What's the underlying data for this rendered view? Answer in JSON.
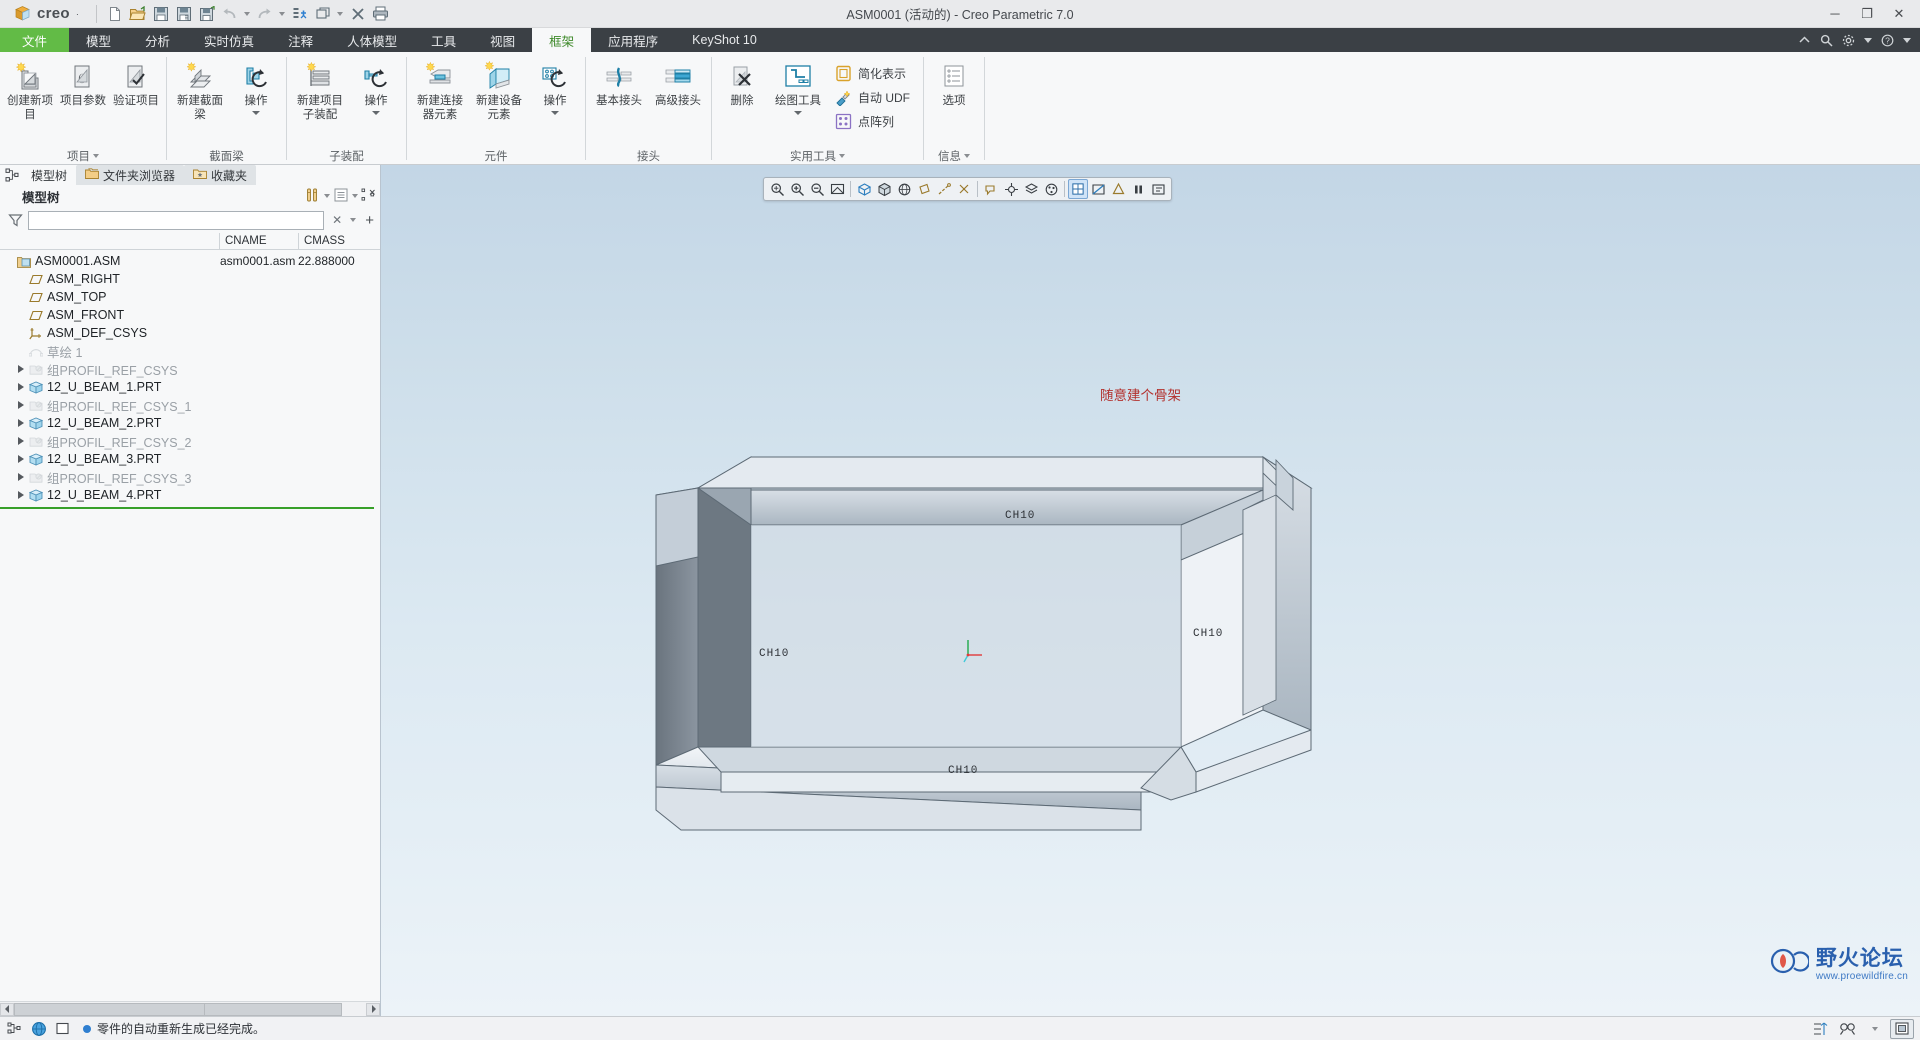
{
  "titlebar": {
    "app_name": "creo",
    "registered_mark": "·",
    "title": "ASM0001 (活动的) - Creo Parametric 7.0",
    "quick_access": [
      {
        "name": "new-file-button",
        "icon": "new-document-icon"
      },
      {
        "name": "open-file-button",
        "icon": "open-folder-icon"
      },
      {
        "name": "save-button",
        "icon": "save-disk-icon"
      },
      {
        "name": "save-as-button",
        "icon": "save-as-icon"
      },
      {
        "name": "save-copy-button",
        "icon": "save-copy-icon"
      },
      {
        "name": "undo-button",
        "icon": "undo-arrow-icon"
      },
      {
        "name": "redo-button",
        "icon": "redo-arrow-icon"
      },
      {
        "name": "regenerate-button",
        "icon": "regenerate-icon"
      },
      {
        "name": "window-button",
        "icon": "window-icon"
      },
      {
        "name": "close-window-button",
        "icon": "close-x-icon"
      },
      {
        "name": "print-button",
        "icon": "printer-icon"
      }
    ],
    "window_controls": {
      "minimize": "─",
      "maximize": "❐",
      "close": "✕"
    }
  },
  "tabs": [
    {
      "label": "文件",
      "name": "tab-file",
      "kind": "file"
    },
    {
      "label": "模型",
      "name": "tab-model",
      "kind": "normal"
    },
    {
      "label": "分析",
      "name": "tab-analysis",
      "kind": "normal"
    },
    {
      "label": "实时仿真",
      "name": "tab-realtime-sim",
      "kind": "normal"
    },
    {
      "label": "注释",
      "name": "tab-annotate",
      "kind": "normal"
    },
    {
      "label": "人体模型",
      "name": "tab-manikin",
      "kind": "normal"
    },
    {
      "label": "工具",
      "name": "tab-tools",
      "kind": "normal"
    },
    {
      "label": "视图",
      "name": "tab-view",
      "kind": "normal"
    },
    {
      "label": "框架",
      "name": "tab-framework",
      "kind": "active"
    },
    {
      "label": "应用程序",
      "name": "tab-applications",
      "kind": "normal"
    },
    {
      "label": "KeyShot 10",
      "name": "tab-keyshot",
      "kind": "normal"
    }
  ],
  "ribbon": {
    "groups": [
      {
        "name": "group-project",
        "label": "项目",
        "has_caret": true,
        "items": [
          {
            "name": "create-new-project-button",
            "label": "创建新项目",
            "icon": "new-project-icon",
            "caret": false,
            "size": "big"
          },
          {
            "name": "project-params-button",
            "label": "项目参数",
            "icon": "project-params-icon",
            "caret": false,
            "size": "big"
          },
          {
            "name": "verify-project-button",
            "label": "验证项目",
            "icon": "verify-project-icon",
            "caret": false,
            "size": "big"
          }
        ]
      },
      {
        "name": "group-section-beam",
        "label": "截面梁",
        "has_caret": false,
        "items": [
          {
            "name": "new-section-beam-button",
            "label": "新建截面梁",
            "icon": "new-beam-icon",
            "caret": false,
            "size": "big"
          },
          {
            "name": "beam-operations-button",
            "label": "操作",
            "icon": "beam-operations-icon",
            "caret": true,
            "size": "big"
          }
        ]
      },
      {
        "name": "group-subassembly",
        "label": "子装配",
        "has_caret": false,
        "items": [
          {
            "name": "new-project-subassembly-button",
            "label": "新建项目子装配",
            "icon": "new-subassembly-icon",
            "caret": false,
            "size": "big"
          },
          {
            "name": "subassembly-operations-button",
            "label": "操作",
            "icon": "subassembly-operations-icon",
            "caret": true,
            "size": "big"
          }
        ]
      },
      {
        "name": "group-component",
        "label": "元件",
        "has_caret": false,
        "items": [
          {
            "name": "new-connector-element-button",
            "label": "新建连接器元素",
            "icon": "new-connector-icon",
            "caret": false,
            "size": "big"
          },
          {
            "name": "new-equipment-element-button",
            "label": "新建设备元素",
            "icon": "new-equipment-icon",
            "caret": false,
            "size": "big"
          },
          {
            "name": "component-operations-button",
            "label": "操作",
            "icon": "component-operations-icon",
            "caret": true,
            "size": "big"
          }
        ]
      },
      {
        "name": "group-joint",
        "label": "接头",
        "has_caret": false,
        "items": [
          {
            "name": "basic-joint-button",
            "label": "基本接头",
            "icon": "basic-joint-icon",
            "caret": false,
            "size": "big"
          },
          {
            "name": "advanced-joint-button",
            "label": "高级接头",
            "icon": "advanced-joint-icon",
            "caret": false,
            "size": "big"
          }
        ]
      },
      {
        "name": "group-utilities",
        "label": "实用工具",
        "has_caret": true,
        "items": [
          {
            "name": "delete-button",
            "label": "删除",
            "icon": "delete-icon",
            "caret": false,
            "size": "big"
          },
          {
            "name": "drawing-tools-button",
            "label": "绘图工具",
            "icon": "drawing-tools-icon",
            "caret": true,
            "size": "big"
          }
        ],
        "small_items": [
          {
            "name": "simplified-rep-button",
            "label": "简化表示",
            "icon": "simplified-rep-icon"
          },
          {
            "name": "auto-udf-button",
            "label": "自动 UDF",
            "icon": "auto-udf-icon"
          },
          {
            "name": "point-array-button",
            "label": "点阵列",
            "icon": "point-array-icon"
          }
        ]
      },
      {
        "name": "group-info",
        "label": "信息",
        "has_caret": true,
        "items": [
          {
            "name": "options-button",
            "label": "选项",
            "icon": "options-icon",
            "caret": false,
            "size": "big"
          }
        ]
      }
    ]
  },
  "left_panel": {
    "nav_tabs": [
      {
        "label": "模型树",
        "name": "nav-tab-model-tree",
        "icon": "model-tree-icon",
        "active": true
      },
      {
        "label": "文件夹浏览器",
        "name": "nav-tab-folder-browser",
        "icon": "folder-browser-icon",
        "active": false
      },
      {
        "label": "收藏夹",
        "name": "nav-tab-favorites",
        "icon": "favorites-folder-icon",
        "active": false
      }
    ],
    "tree_title": "模型树",
    "filter_value": "",
    "filter_placeholder": "",
    "columns": [
      "",
      "CNAME",
      "CMASS"
    ],
    "tree": [
      {
        "label": "ASM0001.ASM",
        "icon": "assembly-icon",
        "indent": 0,
        "expander": false,
        "dim": false,
        "cname": "asm0001.asm",
        "cmass": "22.888000"
      },
      {
        "label": "ASM_RIGHT",
        "icon": "datum-plane-icon",
        "indent": 1,
        "expander": false,
        "dim": false,
        "cname": "",
        "cmass": ""
      },
      {
        "label": "ASM_TOP",
        "icon": "datum-plane-icon",
        "indent": 1,
        "expander": false,
        "dim": false,
        "cname": "",
        "cmass": ""
      },
      {
        "label": "ASM_FRONT",
        "icon": "datum-plane-icon",
        "indent": 1,
        "expander": false,
        "dim": false,
        "cname": "",
        "cmass": ""
      },
      {
        "label": "ASM_DEF_CSYS",
        "icon": "coordinate-system-icon",
        "indent": 1,
        "expander": false,
        "dim": false,
        "cname": "",
        "cmass": ""
      },
      {
        "label": "草绘 1",
        "icon": "sketch-icon",
        "indent": 1,
        "expander": false,
        "dim": true,
        "cname": "",
        "cmass": ""
      },
      {
        "label": "组PROFIL_REF_CSYS",
        "icon": "group-icon",
        "indent": 1,
        "expander": true,
        "dim": true,
        "cname": "",
        "cmass": ""
      },
      {
        "label": "12_U_BEAM_1.PRT",
        "icon": "part-icon",
        "indent": 1,
        "expander": true,
        "dim": false,
        "cname": "",
        "cmass": ""
      },
      {
        "label": "组PROFIL_REF_CSYS_1",
        "icon": "group-icon",
        "indent": 1,
        "expander": true,
        "dim": true,
        "cname": "",
        "cmass": ""
      },
      {
        "label": "12_U_BEAM_2.PRT",
        "icon": "part-icon",
        "indent": 1,
        "expander": true,
        "dim": false,
        "cname": "",
        "cmass": ""
      },
      {
        "label": "组PROFIL_REF_CSYS_2",
        "icon": "group-icon",
        "indent": 1,
        "expander": true,
        "dim": true,
        "cname": "",
        "cmass": ""
      },
      {
        "label": "12_U_BEAM_3.PRT",
        "icon": "part-icon",
        "indent": 1,
        "expander": true,
        "dim": false,
        "cname": "",
        "cmass": ""
      },
      {
        "label": "组PROFIL_REF_CSYS_3",
        "icon": "group-icon",
        "indent": 1,
        "expander": true,
        "dim": true,
        "cname": "",
        "cmass": ""
      },
      {
        "label": "12_U_BEAM_4.PRT",
        "icon": "part-icon",
        "indent": 1,
        "expander": true,
        "dim": false,
        "cname": "",
        "cmass": ""
      }
    ]
  },
  "viewport": {
    "annotation_text": "随意建个骨架",
    "beam_labels": [
      "CH10",
      "CH10",
      "CH10",
      "CH10"
    ],
    "graphics_toolbar": [
      {
        "name": "refit-icon",
        "sel": false
      },
      {
        "name": "zoom-in-icon",
        "sel": false
      },
      {
        "name": "zoom-out-icon",
        "sel": false
      },
      {
        "name": "repaint-icon",
        "sel": false
      },
      {
        "name": "sep",
        "sel": false
      },
      {
        "name": "saved-orientations-icon",
        "sel": false
      },
      {
        "name": "display-style-icon",
        "sel": false
      },
      {
        "name": "perspective-view-icon",
        "sel": false
      },
      {
        "name": "datum-display-planes-icon",
        "sel": false
      },
      {
        "name": "datum-display-axes-icon",
        "sel": false
      },
      {
        "name": "datum-display-points-icon",
        "sel": false
      },
      {
        "name": "sep",
        "sel": false
      },
      {
        "name": "annotation-display-icon",
        "sel": false
      },
      {
        "name": "spin-center-icon",
        "sel": false
      },
      {
        "name": "layer-display-icon",
        "sel": false
      },
      {
        "name": "appearance-gallery-icon",
        "sel": false
      },
      {
        "name": "sep",
        "sel": false
      },
      {
        "name": "view-manager-icon",
        "sel": true
      },
      {
        "name": "section-view-icon",
        "sel": false
      },
      {
        "name": "shading-icon",
        "sel": false
      },
      {
        "name": "pause-playback-icon",
        "sel": false
      },
      {
        "name": "stop-playback-icon",
        "sel": false
      }
    ],
    "watermark": {
      "name_cn": "野火论坛",
      "url": "www.proewildfire.cn"
    }
  },
  "statusbar": {
    "message": "零件的自动重新生成已经完成。",
    "left_icons": [
      "selection-filter-icon",
      "globe-icon",
      "selection-box-icon"
    ],
    "right_icons": [
      "model-tree-filter-icon",
      "search-icon",
      "notification-icon"
    ]
  },
  "colors": {
    "file_tab_green": "#62bb46",
    "active_tab_text": "#3f8a2b",
    "tabstrip_bg": "#3b4045",
    "accent_blue": "#2f7fd0",
    "annotation_red": "#b3322f",
    "tree_green_line": "#37a02a",
    "watermark_blue": "#1a54a8"
  }
}
